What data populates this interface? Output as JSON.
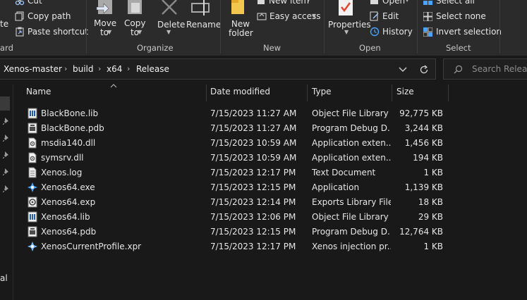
{
  "ribbon": {
    "clipboard": {
      "cut": "Cut",
      "copy_path": "Copy path",
      "paste_shortcut": "Paste shortcut",
      "partial_left_text": "te",
      "group_label": "ard"
    },
    "organize": {
      "move_to": "Move to",
      "copy_to": "Copy to",
      "delete": "Delete",
      "rename": "Rename",
      "group_label": "Organize"
    },
    "new": {
      "new_folder": "New folder",
      "new_item": "New item",
      "easy_access": "Easy access",
      "group_label": "New"
    },
    "open": {
      "properties": "Properties",
      "open": "Open",
      "edit": "Edit",
      "history": "History",
      "group_label": "Open"
    },
    "select": {
      "select_all": "Select all",
      "select_none": "Select none",
      "invert_selection": "Invert selection",
      "group_label": "Select"
    }
  },
  "address": {
    "crumbs": [
      "Xenos-master",
      "build",
      "x64",
      "Release"
    ],
    "search_placeholder": "Search Release"
  },
  "nav_pane": {
    "partial_label": "al"
  },
  "columns": {
    "name": "Name",
    "date_modified": "Date modified",
    "type": "Type",
    "size": "Size"
  },
  "files": [
    {
      "name": "BlackBone.lib",
      "date": "7/15/2023 11:27 AM",
      "type": "Object File Library",
      "size": "92,775 KB",
      "icon": "lib-file-icon"
    },
    {
      "name": "BlackBone.pdb",
      "date": "7/15/2023 11:27 AM",
      "type": "Program Debug D...",
      "size": "3,244 KB",
      "icon": "pdb-file-icon"
    },
    {
      "name": "msdia140.dll",
      "date": "7/15/2023 10:59 AM",
      "type": "Application exten...",
      "size": "1,456 KB",
      "icon": "dll-file-icon"
    },
    {
      "name": "symsrv.dll",
      "date": "7/15/2023 10:59 AM",
      "type": "Application exten...",
      "size": "194 KB",
      "icon": "dll-file-icon"
    },
    {
      "name": "Xenos.log",
      "date": "7/15/2023 12:17 PM",
      "type": "Text Document",
      "size": "1 KB",
      "icon": "text-file-icon"
    },
    {
      "name": "Xenos64.exe",
      "date": "7/15/2023 12:15 PM",
      "type": "Application",
      "size": "1,139 KB",
      "icon": "exe-app-icon"
    },
    {
      "name": "Xenos64.exp",
      "date": "7/15/2023 12:14 PM",
      "type": "Exports Library File",
      "size": "18 KB",
      "icon": "exp-file-icon"
    },
    {
      "name": "Xenos64.lib",
      "date": "7/15/2023 12:06 PM",
      "type": "Object File Library",
      "size": "29 KB",
      "icon": "lib-file-icon"
    },
    {
      "name": "Xenos64.pdb",
      "date": "7/15/2023 12:15 PM",
      "type": "Program Debug D...",
      "size": "12,764 KB",
      "icon": "pdb-file-icon"
    },
    {
      "name": "XenosCurrentProfile.xpr",
      "date": "7/15/2023 12:17 PM",
      "type": "Xenos injection pr...",
      "size": "1 KB",
      "icon": "xpr-file-icon"
    }
  ],
  "colors": {
    "background": "#191919",
    "ribbon": "#2b2b2b",
    "text": "#e6e6e6",
    "accent_blue": "#4aa3ff",
    "properties_red": "#e04a2f",
    "folder_yellow": "#f3c74e"
  }
}
